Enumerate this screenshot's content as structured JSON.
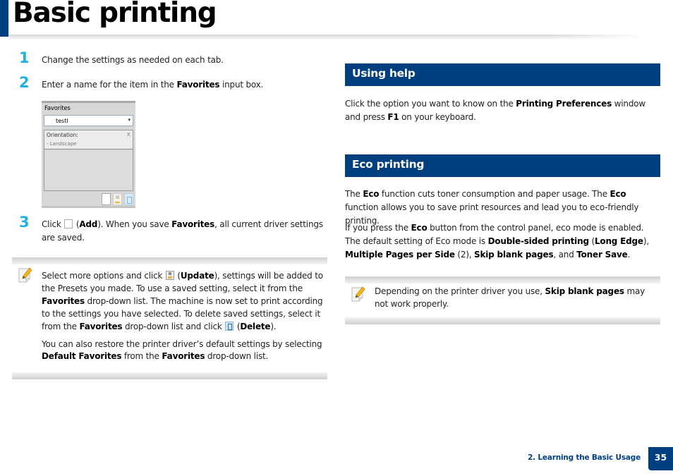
{
  "page": {
    "title": "Basic printing",
    "footer": {
      "section": "2. Learning the Basic Usage",
      "page_number": "35"
    },
    "colors": {
      "brand": "#003f7f",
      "step_number": "#1eb0e6"
    }
  },
  "steps": [
    {
      "number": "1",
      "parts": [
        {
          "t": "Change the settings as needed on each tab."
        }
      ]
    },
    {
      "number": "2",
      "parts": [
        {
          "t": "Enter a name for the item in the "
        },
        {
          "b": "Favorites"
        },
        {
          "t": " input box."
        }
      ]
    },
    {
      "number": "3",
      "parts": [
        {
          "t": "Click "
        },
        {
          "icon": "add-icon"
        },
        {
          "t": " ("
        },
        {
          "b": "Add"
        },
        {
          "t": "). When you save "
        },
        {
          "b": "Favorites"
        },
        {
          "t": ", all current driver settings are saved."
        }
      ]
    }
  ],
  "favorites_panel": {
    "label": "Favorites",
    "dropdown_value": "testl",
    "dropdown_caret": "▾",
    "list_items": [
      {
        "name": "Orientation:",
        "close": "x",
        "value": "- Landscape"
      }
    ],
    "tools": [
      "add-icon",
      "update-icon",
      "delete-icon"
    ]
  },
  "note_left": {
    "icon": "note-pencil-icon",
    "paragraphs": [
      [
        {
          "t": "Select more options and click "
        },
        {
          "icon": "update-icon"
        },
        {
          "t": " ("
        },
        {
          "b": "Update"
        },
        {
          "t": "), settings will be added to the Presets you made. To use a saved setting, select it from the "
        },
        {
          "b": "Favorites"
        },
        {
          "t": " drop-down list. The machine is now set to print according to the settings you have selected. To delete saved settings, select it from the "
        },
        {
          "b": "Favorites"
        },
        {
          "t": " drop-down list and click "
        },
        {
          "icon": "delete-icon"
        },
        {
          "t": " ("
        },
        {
          "b": "Delete"
        },
        {
          "t": ")."
        }
      ],
      [
        {
          "t": "You can also restore the printer driver’s default settings by selecting "
        },
        {
          "b": "Default Favorites"
        },
        {
          "t": " from the "
        },
        {
          "b": "Favorites"
        },
        {
          "t": " drop-down list."
        }
      ]
    ]
  },
  "sections": [
    {
      "title": "Using help",
      "paragraphs": [
        [
          {
            "t": "Click the option you want to know on the "
          },
          {
            "b": "Printing Preferences"
          },
          {
            "t": " window and press "
          },
          {
            "b": "F1"
          },
          {
            "t": " on your keyboard."
          }
        ]
      ]
    },
    {
      "title": "Eco printing",
      "paragraphs": [
        [
          {
            "t": "The "
          },
          {
            "b": "Eco"
          },
          {
            "t": " function cuts toner consumption and paper usage. The "
          },
          {
            "b": "Eco"
          },
          {
            "t": " function allows you to save print resources and lead you to eco-friendly printing."
          }
        ],
        [
          {
            "t": "If you press the "
          },
          {
            "b": "Eco"
          },
          {
            "t": " button from the control panel, eco mode is enabled. The default setting of Eco mode is "
          },
          {
            "b": "Double-sided printing"
          },
          {
            "t": " ("
          },
          {
            "b": "Long Edge"
          },
          {
            "t": "), "
          },
          {
            "b": "Multiple Pages per Side"
          },
          {
            "t": " (2), "
          },
          {
            "b": "Skip blank pages"
          },
          {
            "t": ", and "
          },
          {
            "b": "Toner Save"
          },
          {
            "t": "."
          }
        ]
      ]
    }
  ],
  "note_right": {
    "icon": "note-pencil-icon",
    "paragraphs": [
      [
        {
          "t": "Depending on the printer driver you use, "
        },
        {
          "b": "Skip blank pages"
        },
        {
          "t": " may not work properly."
        }
      ]
    ]
  }
}
